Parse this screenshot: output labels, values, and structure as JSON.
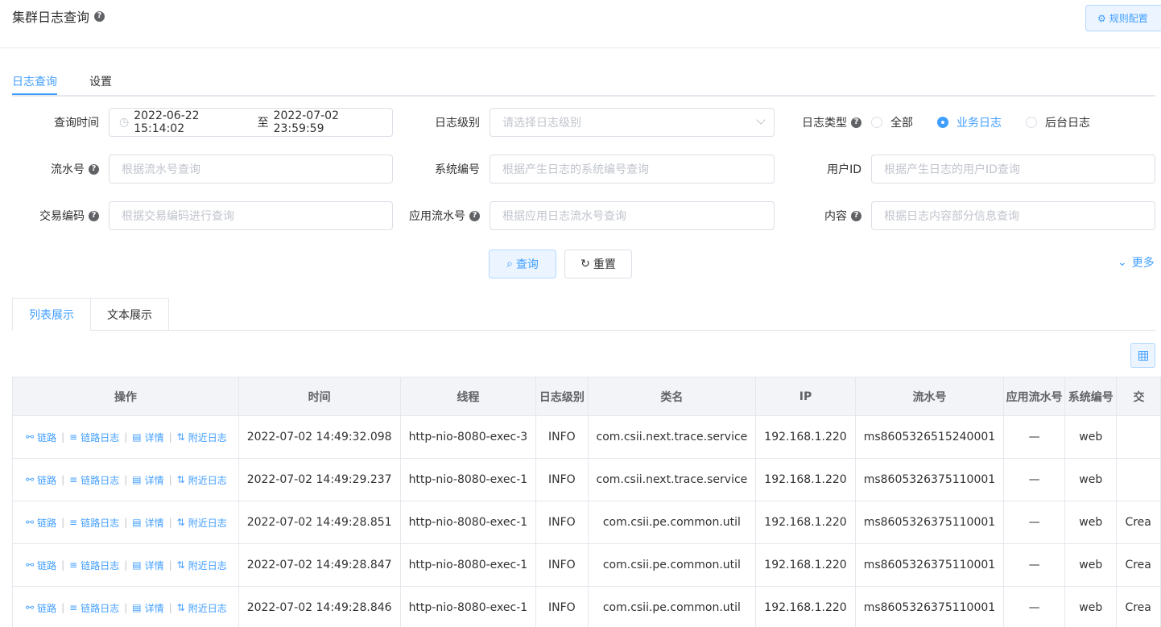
{
  "header": {
    "title": "集群日志查询",
    "rule_button": "规则配置"
  },
  "tabs": [
    {
      "label": "日志查询"
    },
    {
      "label": "设置"
    }
  ],
  "form": {
    "query_time_label": "查询时间",
    "query_time_start": "2022-06-22 15:14:02",
    "query_time_sep": "至",
    "query_time_end": "2022-07-02 23:59:59",
    "log_level_label": "日志级别",
    "log_level_placeholder": "请选择日志级别",
    "log_type_label": "日志类型",
    "log_type_options": [
      "全部",
      "业务日志",
      "后台日志"
    ],
    "log_type_selected": "业务日志",
    "serial_label": "流水号",
    "serial_placeholder": "根据流水号查询",
    "system_code_label": "系统编号",
    "system_code_placeholder": "根据产生日志的系统编号查询",
    "user_id_label": "用户ID",
    "user_id_placeholder": "根据产生日志的用户ID查询",
    "trade_code_label": "交易编码",
    "trade_code_placeholder": "根据交易编码进行查询",
    "app_serial_label": "应用流水号",
    "app_serial_placeholder": "根据应用日志流水号查询",
    "content_label": "内容",
    "content_placeholder": "根据日志内容部分信息查询",
    "search_button": "查询",
    "reset_button": "重置",
    "more_link": "更多"
  },
  "view_tabs": [
    {
      "label": "列表展示"
    },
    {
      "label": "文本展示"
    }
  ],
  "table": {
    "columns": [
      "操作",
      "时间",
      "线程",
      "日志级别",
      "类名",
      "IP",
      "流水号",
      "应用流水号",
      "系统编号",
      "交"
    ],
    "actions": [
      "链路",
      "链路日志",
      "详情",
      "附近日志"
    ],
    "rows": [
      {
        "time": "2022-07-02 14:49:32.098",
        "thread": "http-nio-8080-exec-3",
        "level": "INFO",
        "class": "com.csii.next.trace.service",
        "ip": "192.168.1.220",
        "serial": "ms8605326515240001",
        "app_serial": "—",
        "system": "web",
        "trade": ""
      },
      {
        "time": "2022-07-02 14:49:29.237",
        "thread": "http-nio-8080-exec-1",
        "level": "INFO",
        "class": "com.csii.next.trace.service",
        "ip": "192.168.1.220",
        "serial": "ms8605326375110001",
        "app_serial": "—",
        "system": "web",
        "trade": ""
      },
      {
        "time": "2022-07-02 14:49:28.851",
        "thread": "http-nio-8080-exec-1",
        "level": "INFO",
        "class": "com.csii.pe.common.util",
        "ip": "192.168.1.220",
        "serial": "ms8605326375110001",
        "app_serial": "—",
        "system": "web",
        "trade": "Crea"
      },
      {
        "time": "2022-07-02 14:49:28.847",
        "thread": "http-nio-8080-exec-1",
        "level": "INFO",
        "class": "com.csii.pe.common.util",
        "ip": "192.168.1.220",
        "serial": "ms8605326375110001",
        "app_serial": "—",
        "system": "web",
        "trade": "Crea"
      },
      {
        "time": "2022-07-02 14:49:28.846",
        "thread": "http-nio-8080-exec-1",
        "level": "INFO",
        "class": "com.csii.pe.common.util",
        "ip": "192.168.1.220",
        "serial": "ms8605326375110001",
        "app_serial": "—",
        "system": "web",
        "trade": "Crea"
      }
    ]
  },
  "colors": {
    "accent": "#409eff",
    "border": "#dcdfe6",
    "header_bg": "#f2f4f7"
  }
}
